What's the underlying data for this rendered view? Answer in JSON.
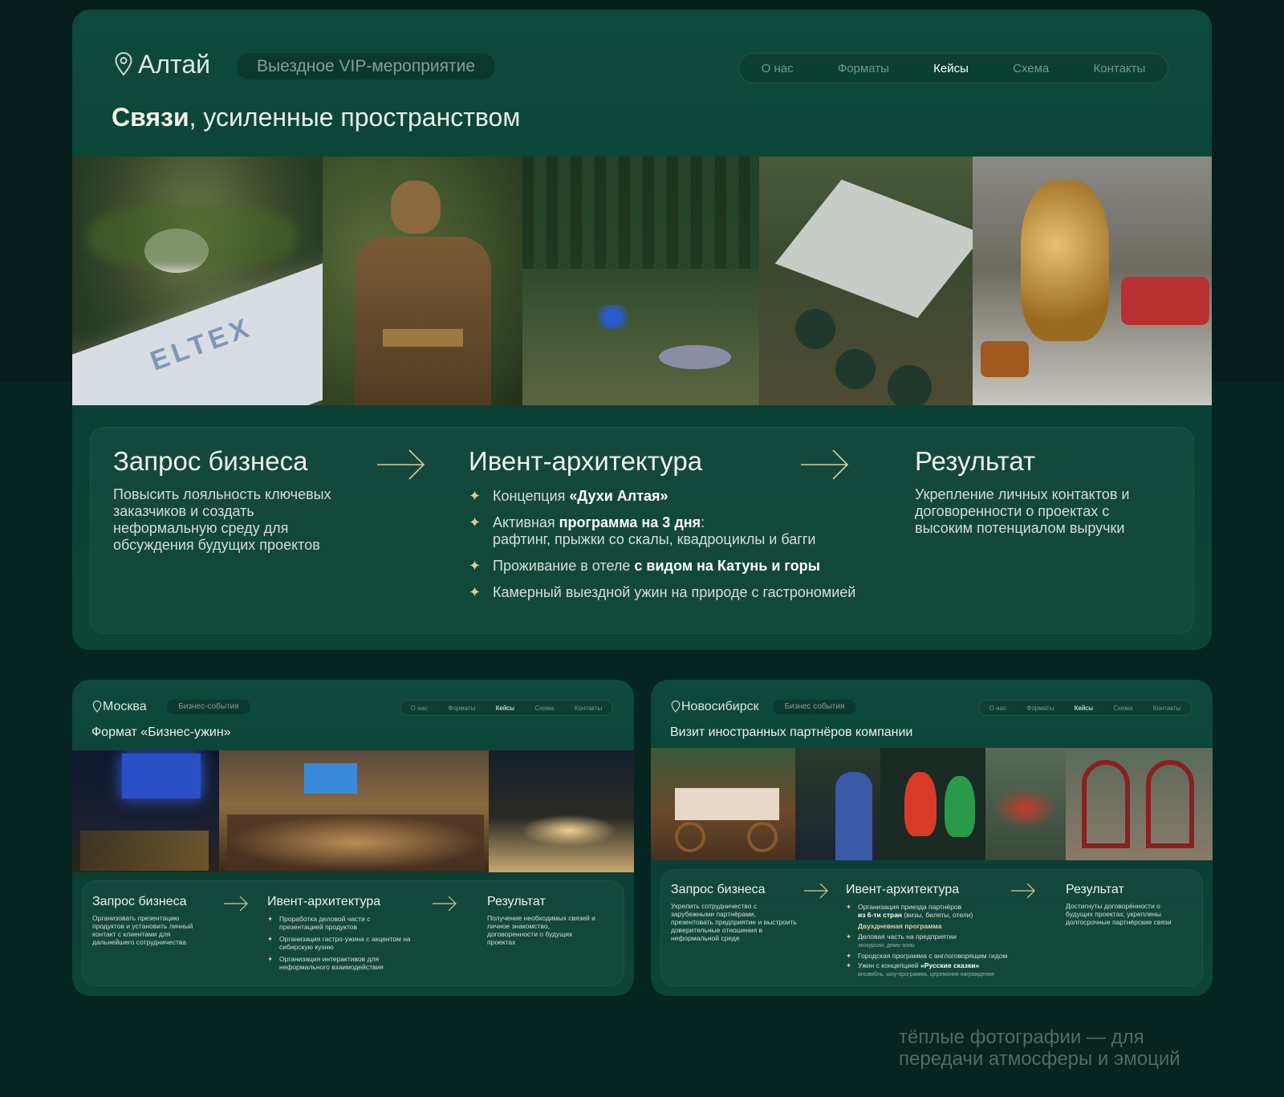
{
  "main": {
    "location": "Алтай",
    "event_type": "Выездное VIP-мероприятие",
    "nav": [
      "О нас",
      "Форматы",
      "Кейсы",
      "Схема",
      "Контакты"
    ],
    "nav_active": "Кейсы",
    "headline_bold": "Связи",
    "headline_rest": ", усиленные пространством",
    "request_title": "Запрос бизнеса",
    "request_text": "Повысить лояльность ключевых заказчиков и создать неформальную среду для обсуждения будущих проектов",
    "arch_title": "Ивент-архитектура",
    "arch_items": [
      {
        "pre": "Концепция ",
        "bold": "«Духи Алтая»",
        "post": "",
        "sub": ""
      },
      {
        "pre": "Активная ",
        "bold": "программа на 3 дня",
        "post": ":",
        "sub": "рафтинг,  прыжки со скалы, квадроциклы и багги"
      },
      {
        "pre": "Проживание в отеле ",
        "bold": "с видом на Катунь и горы",
        "post": "",
        "sub": ""
      },
      {
        "pre": "Камерный выездной ужин на природе с гастрономией",
        "bold": "",
        "post": "",
        "sub": ""
      }
    ],
    "result_title": "Результат",
    "result_text": "Укрепление личных контактов и договоренности о проектах с высоким потенциалом выручки",
    "photo_logo": "ELTEX"
  },
  "moscow": {
    "location": "Москва",
    "event_type": "Бизнес-события",
    "nav": [
      "О нас",
      "Форматы",
      "Кейсы",
      "Схема",
      "Контакты"
    ],
    "headline": "Формат «Бизнес-ужин»",
    "request_title": "Запрос бизнеса",
    "request_text": "Организовать презентацию продуктов и установить личный контакт с клиентами для дальнейшего сотрудничества",
    "arch_title": "Ивент-архитектура",
    "arch_items": [
      "Проработка деловой части с презентацией продуктов",
      "Организация гастро-ужина с акцентом на сибирскую кухню",
      "Организация интерактивов для неформального взаимодействия"
    ],
    "result_title": "Результат",
    "result_text": "Получение необходимых связей и личное знакомство, договоренности о будущих проектах"
  },
  "novosibirsk": {
    "location": "Новосибирск",
    "event_type": "Бизнес события",
    "nav": [
      "О нас",
      "Форматы",
      "Кейсы",
      "Схема",
      "Контакты"
    ],
    "headline": "Визит иностранных партнёров компании",
    "request_title": "Запрос бизнеса",
    "request_text": "Укрепить сотрудничество с зарубежными партнёрами, презентовать предприятие и выстроить доверительные отношения в неформальной среде",
    "arch_title": "Ивент-архитектура",
    "arch_item1_pre": "Организация приезда партнёров",
    "arch_item1_bold": "из 6-ти стран",
    "arch_item1_post": " (визы, билеты, отели)",
    "two_day": "Двухдневная программа",
    "arch_item2": "Деловая часть на предприятии",
    "arch_item2_sub": "экскурсии, демо-зоны",
    "arch_item3": "Городская программа с англоговорящим гидом",
    "arch_item4_pre": "Ужин с концепцией ",
    "arch_item4_bold": "«Русские сказки»",
    "arch_item4_sub": "ансамбль, шоу-программа, церемония награждения",
    "result_title": "Результат",
    "result_text": "Достигнуты договорённости о будущих проектах, укреплены долгосрочные партнёрские связи"
  },
  "tagline": "тёплые фотографии — для передачи  атмосферы и эмоций",
  "colors": {
    "background": "#062420",
    "card": "#0d4a3c",
    "accent": "#d9caa0"
  }
}
